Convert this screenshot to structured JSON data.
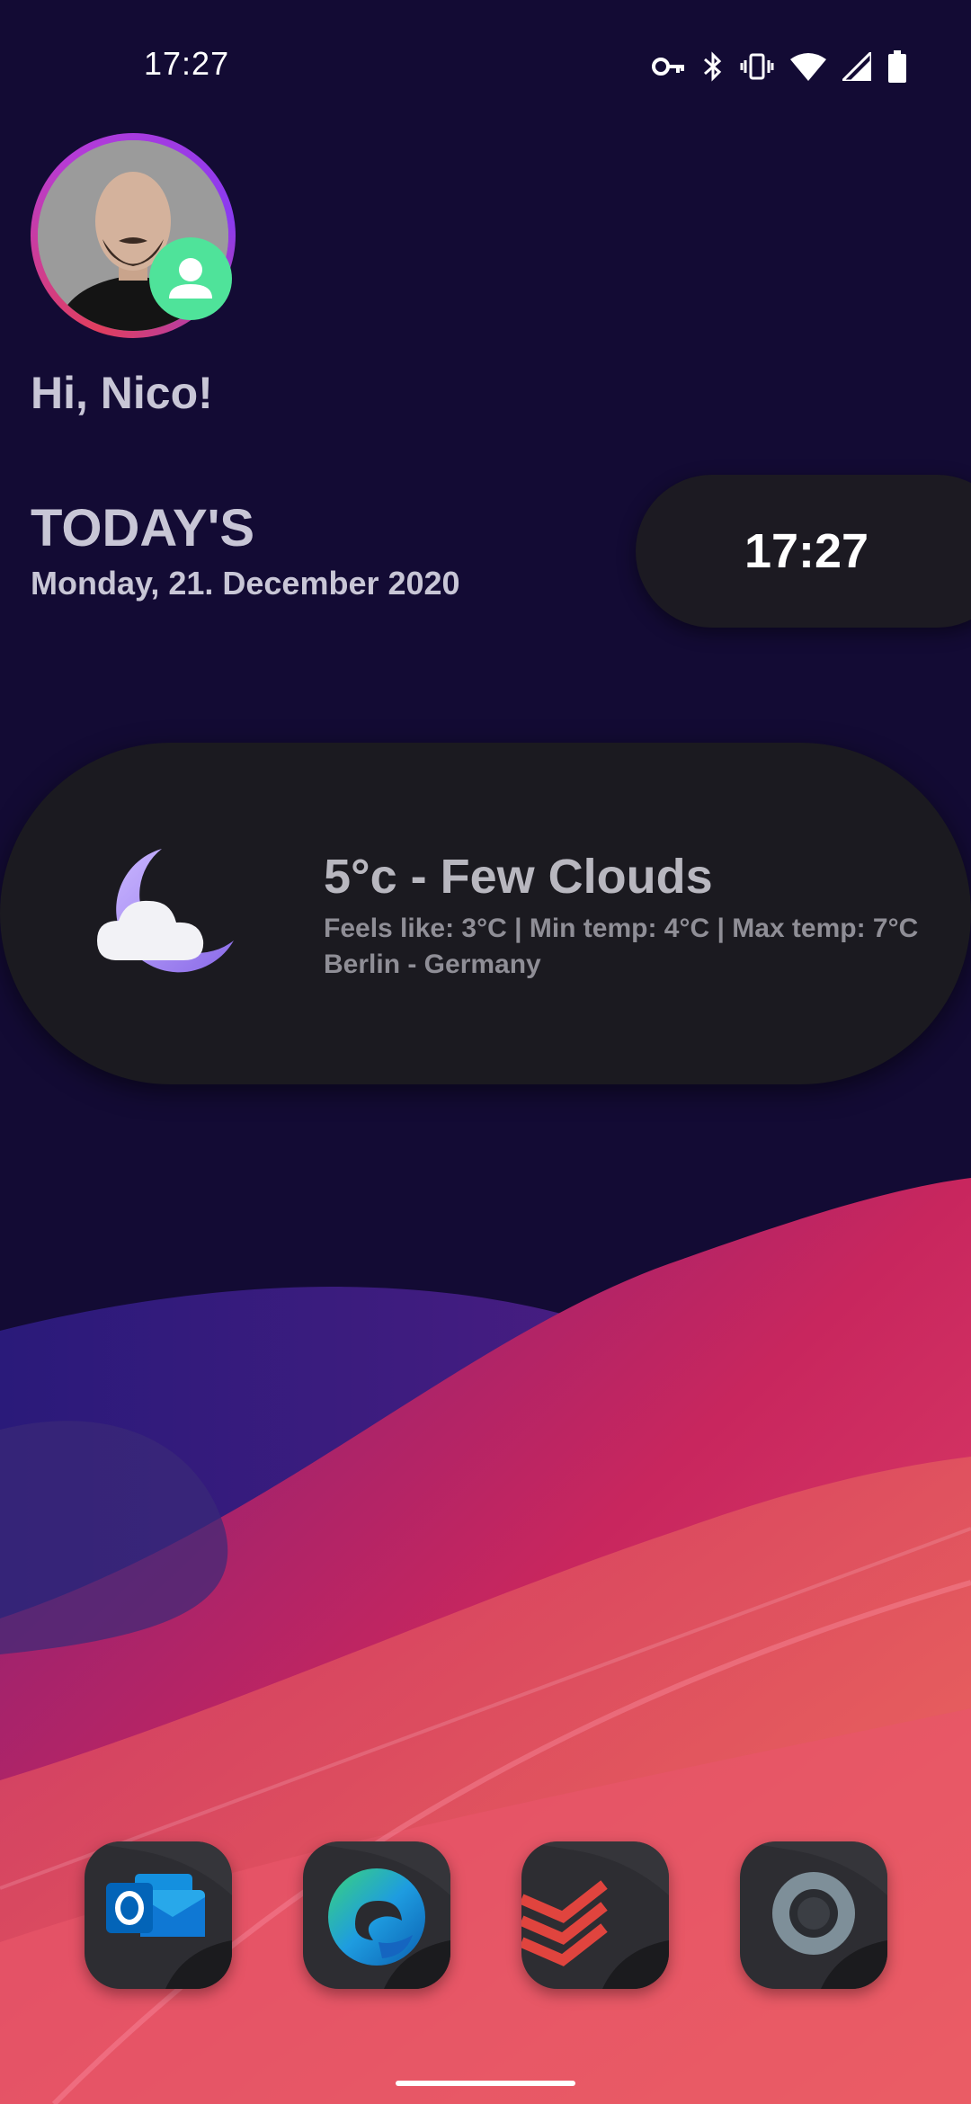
{
  "status_bar": {
    "time": "17:27",
    "icons": [
      "vpn-key-icon",
      "bluetooth-icon",
      "vibrate-icon",
      "wifi-icon",
      "cellular-signal-icon",
      "battery-icon"
    ]
  },
  "profile": {
    "greeting": "Hi, Nico!",
    "avatar": "user-avatar",
    "badge_icon": "person-icon"
  },
  "today": {
    "title": "TODAY'S",
    "date": "Monday, 21. December 2020"
  },
  "clock_widget": {
    "time": "17:27"
  },
  "weather": {
    "icon": "moon-cloud-icon",
    "summary": "5°c - Few Clouds",
    "details": "Feels like: 3°C | Min temp: 4°C | Max temp: 7°C",
    "location": "Berlin - Germany"
  },
  "dock": {
    "apps": [
      {
        "name": "Outlook",
        "icon": "outlook-icon"
      },
      {
        "name": "Edge",
        "icon": "edge-browser-icon"
      },
      {
        "name": "Todoist",
        "icon": "todoist-icon"
      },
      {
        "name": "Camera",
        "icon": "camera-lens-icon"
      }
    ]
  },
  "colors": {
    "background": "#130b34",
    "card": "#1b1a20",
    "badge": "#4fe39a",
    "text_light": "#c8c6d6"
  }
}
